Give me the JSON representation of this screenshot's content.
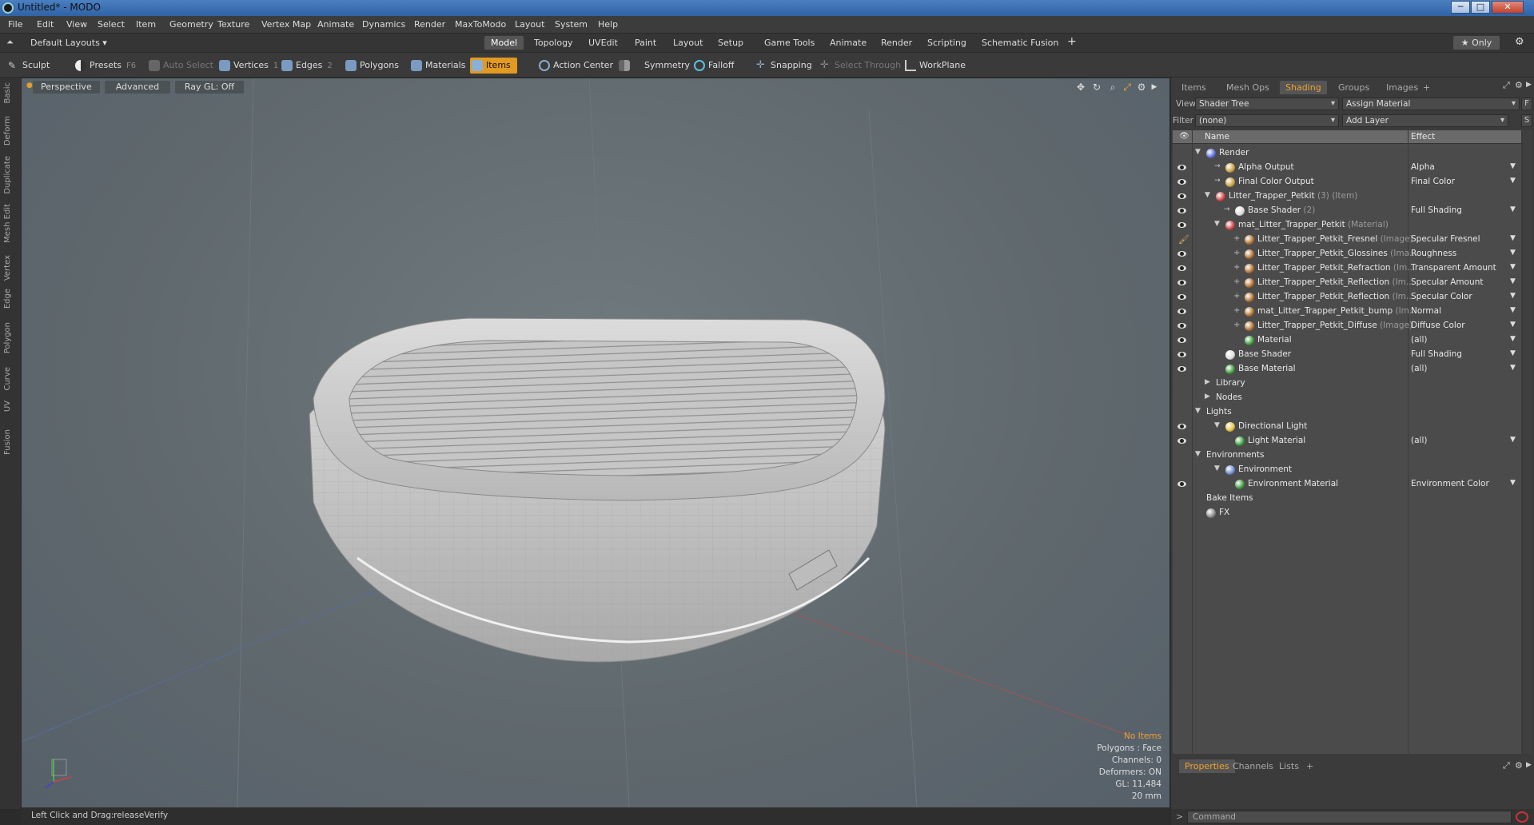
{
  "window": {
    "title": "Untitled* - MODO",
    "min": "─",
    "max": "□",
    "close": "✕"
  },
  "menu": [
    "File",
    "Edit",
    "View",
    "Select",
    "Item",
    "Geometry",
    "Texture",
    "Vertex Map",
    "Animate",
    "Dynamics",
    "Render",
    "MaxToModo",
    "Layout",
    "System",
    "Help"
  ],
  "layoutbar": {
    "layouts_label": "Default Layouts ▾",
    "tabs": [
      "Model",
      "Topology",
      "UVEdit",
      "Paint",
      "Layout",
      "Setup",
      "Game Tools",
      "Animate",
      "Render",
      "Scripting",
      "Schematic Fusion"
    ],
    "active_tab": "Model",
    "add": "+",
    "only": "★ Only",
    "gear": "⚙"
  },
  "toolbar": {
    "sculpt": "Sculpt",
    "presets": "Presets",
    "presets_key": "F6",
    "auto_select": "Auto Select",
    "vertices": "Vertices",
    "vertices_key": "1",
    "edges": "Edges",
    "edges_key": "2",
    "polygons": "Polygons",
    "materials": "Materials",
    "items": "Items",
    "action_center": "Action Center",
    "symmetry": "Symmetry",
    "falloff": "Falloff",
    "snapping": "Snapping",
    "select_through": "Select Through",
    "workplane": "WorkPlane"
  },
  "lefttabs": [
    "Basic",
    "Deform",
    "Duplicate",
    "Mesh Edit",
    "Vertex",
    "Edge",
    "Polygon",
    "Curve",
    "UV",
    "Fusion"
  ],
  "viewport": {
    "view": "Perspective",
    "shading": "Advanced",
    "raygl": "Ray GL: Off",
    "stats": {
      "items": "No Items",
      "polygons": "Polygons : Face",
      "channels": "Channels: 0",
      "deformers": "Deformers: ON",
      "gl": "GL: 11,484",
      "scale": "20 mm"
    }
  },
  "status": {
    "hint": "Left Click and Drag:",
    "action": "releaseVerify"
  },
  "panel": {
    "tabs": [
      "Items",
      "Mesh Ops",
      "Shading",
      "Groups",
      "Images"
    ],
    "active_tab": "Shading",
    "add": "+",
    "view_label": "View",
    "view_value": "Shader Tree",
    "assign_material": "Assign Material",
    "f_btn": "F",
    "filter_label": "Filter",
    "filter_value": "(none)",
    "add_layer": "Add Layer",
    "s_btn": "S",
    "col_name": "Name",
    "col_effect": "Effect",
    "rows": [
      {
        "name": "Render",
        "sub": "",
        "effect": "",
        "indent": 0,
        "arrow": "▼",
        "icon": "#5a6adc",
        "eye": false
      },
      {
        "name": "Alpha Output",
        "sub": "",
        "effect": "Alpha",
        "indent": 2,
        "arrow": "→",
        "icon": "#c8a040",
        "eye": true
      },
      {
        "name": "Final Color Output",
        "sub": "",
        "effect": "Final Color",
        "indent": 2,
        "arrow": "→",
        "icon": "#c8a040",
        "eye": true
      },
      {
        "name": "Litter_Trapper_Petkit",
        "sub": " (3) (Item)",
        "effect": "",
        "indent": 1,
        "arrow": "▼",
        "icon": "#c84040",
        "eye": true
      },
      {
        "name": "Base Shader",
        "sub": " (2)",
        "effect": "Full Shading",
        "indent": 3,
        "arrow": "→",
        "icon": "#dcdcdc",
        "eye": true
      },
      {
        "name": "mat_Litter_Trapper_Petkit",
        "sub": " (Material)",
        "effect": "",
        "indent": 2,
        "arrow": "▼",
        "icon": "#c84040",
        "eye": true
      },
      {
        "name": "Litter_Trapper_Petkit_Fresnel",
        "sub": " (Image)",
        "effect": "Specular Fresnel",
        "indent": 4,
        "arrow": "+",
        "icon": "#b07030",
        "eye": false,
        "brush": true
      },
      {
        "name": "Litter_Trapper_Petkit_Glossines",
        "sub": " (Ima...",
        "effect": "Roughness",
        "indent": 4,
        "arrow": "+",
        "icon": "#b07030",
        "eye": true
      },
      {
        "name": "Litter_Trapper_Petkit_Refraction",
        "sub": " (Im...",
        "effect": "Transparent Amount",
        "indent": 4,
        "arrow": "+",
        "icon": "#b07030",
        "eye": true
      },
      {
        "name": "Litter_Trapper_Petkit_Reflection",
        "sub": " (Im...",
        "effect": "Specular Amount",
        "indent": 4,
        "arrow": "+",
        "icon": "#b07030",
        "eye": true
      },
      {
        "name": "Litter_Trapper_Petkit_Reflection",
        "sub": " (Im...",
        "effect": "Specular Color",
        "indent": 4,
        "arrow": "+",
        "icon": "#b07030",
        "eye": true
      },
      {
        "name": "mat_Litter_Trapper_Petkit_bump",
        "sub": " (Im...",
        "effect": "Normal",
        "indent": 4,
        "arrow": "+",
        "icon": "#b07030",
        "eye": true
      },
      {
        "name": "Litter_Trapper_Petkit_Diffuse",
        "sub": " (Image)",
        "effect": "Diffuse Color",
        "indent": 4,
        "arrow": "+",
        "icon": "#b07030",
        "eye": true
      },
      {
        "name": "Material",
        "sub": "",
        "effect": "(all)",
        "indent": 4,
        "arrow": "",
        "icon": "#3a9a3a",
        "eye": true
      },
      {
        "name": "Base Shader",
        "sub": "",
        "effect": "Full Shading",
        "indent": 2,
        "arrow": "",
        "icon": "#dcdcdc",
        "eye": true
      },
      {
        "name": "Base Material",
        "sub": "",
        "effect": "(all)",
        "indent": 2,
        "arrow": "",
        "icon": "#3a9a3a",
        "eye": true
      },
      {
        "name": "Library",
        "sub": "",
        "effect": "",
        "indent": 1,
        "arrow": "▶",
        "icon": "",
        "eye": false
      },
      {
        "name": "Nodes",
        "sub": "",
        "effect": "",
        "indent": 1,
        "arrow": "▶",
        "icon": "",
        "eye": false
      },
      {
        "name": "Lights",
        "sub": "",
        "effect": "",
        "indent": 0,
        "arrow": "▼",
        "icon": "",
        "eye": false
      },
      {
        "name": "Directional Light",
        "sub": "",
        "effect": "",
        "indent": 2,
        "arrow": "▼",
        "icon": "#e0c040",
        "eye": true
      },
      {
        "name": "Light Material",
        "sub": "",
        "effect": "(all)",
        "indent": 3,
        "arrow": "",
        "icon": "#3a9a3a",
        "eye": true
      },
      {
        "name": "Environments",
        "sub": "",
        "effect": "",
        "indent": 0,
        "arrow": "▼",
        "icon": "",
        "eye": false
      },
      {
        "name": "Environment",
        "sub": "",
        "effect": "",
        "indent": 2,
        "arrow": "▼",
        "icon": "#6a8ad0",
        "eye": false
      },
      {
        "name": "Environment Material",
        "sub": "",
        "effect": "Environment Color",
        "indent": 3,
        "arrow": "",
        "icon": "#3a9a3a",
        "eye": true
      },
      {
        "name": "Bake Items",
        "sub": "",
        "effect": "",
        "indent": 0,
        "arrow": "",
        "icon": "",
        "eye": false
      },
      {
        "name": "FX",
        "sub": "",
        "effect": "",
        "indent": 0,
        "arrow": "",
        "icon": "#888888",
        "eye": false
      }
    ],
    "bottom_tabs": [
      "Properties",
      "Channels",
      "Lists"
    ],
    "bottom_active": "Properties",
    "command_prompt": ">",
    "command_placeholder": "Command"
  }
}
